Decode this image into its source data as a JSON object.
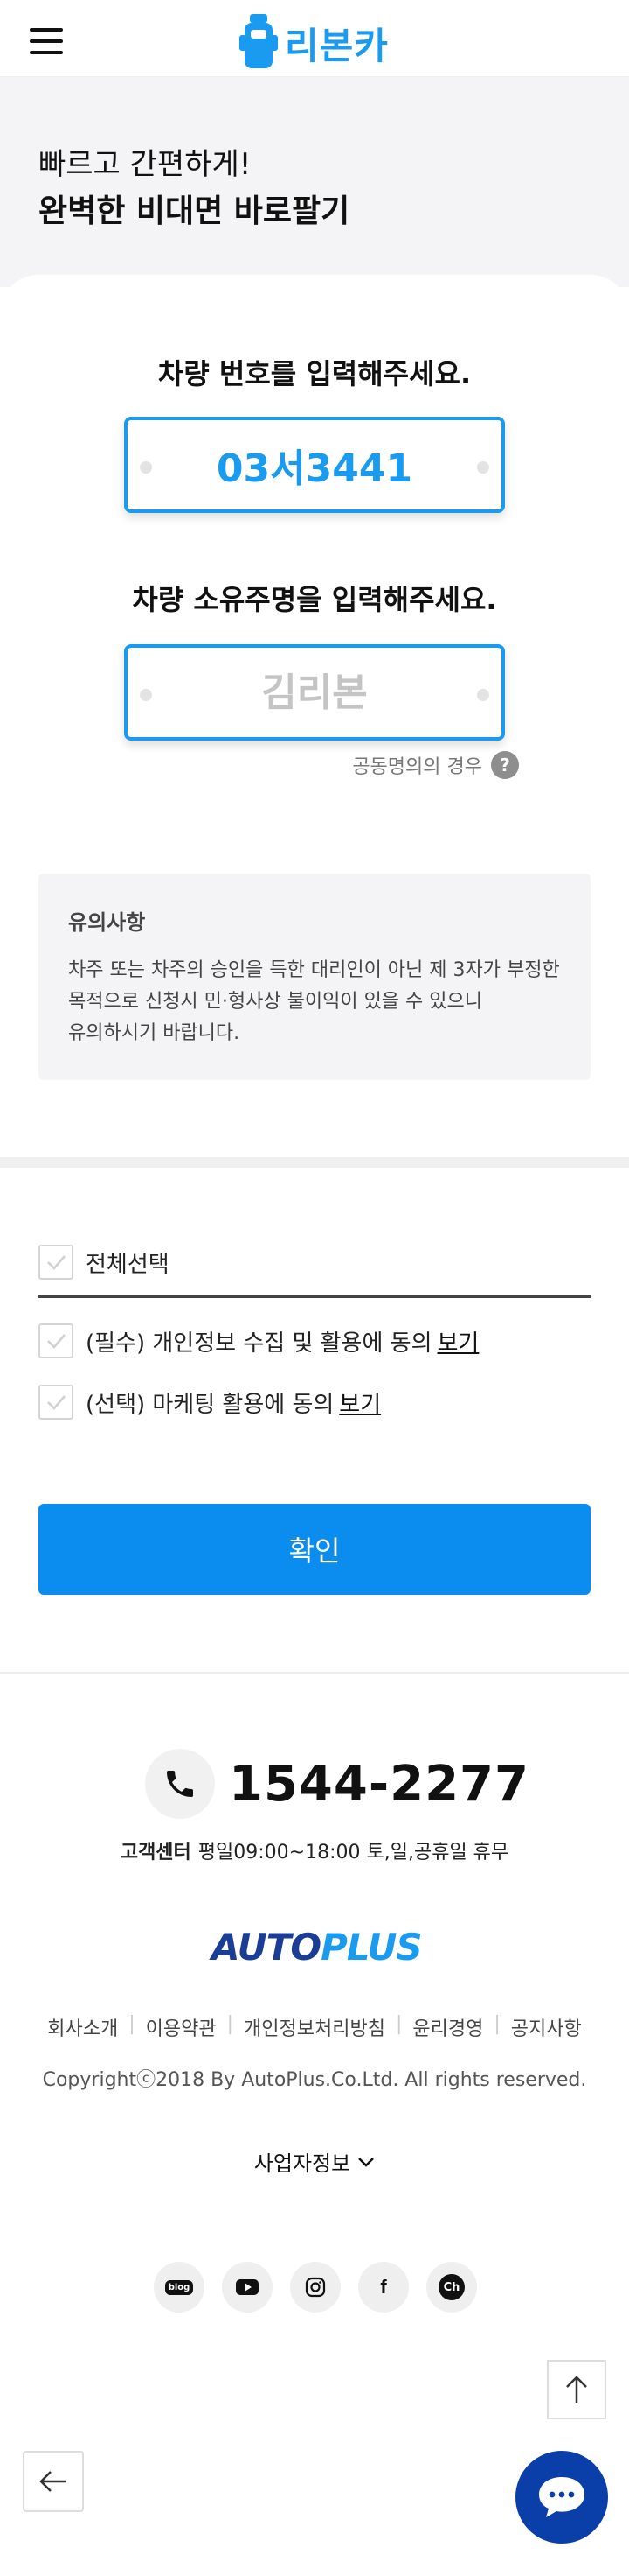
{
  "header": {
    "logo_text": "리본카",
    "menu_icon": "hamburger-menu-icon",
    "brand_color": "#1a9bf0"
  },
  "hero": {
    "subtitle": "빠르고 간편하게!",
    "title": "완벽한 비대면 바로팔기"
  },
  "form": {
    "plate_label": "차량 번호를 입력해주세요.",
    "plate_value": "03서3441",
    "owner_label": "차량 소유주명을 입력해주세요.",
    "owner_placeholder": "김리본",
    "co_owner_link": "공동명의의 경우",
    "help_icon_text": "?"
  },
  "notice": {
    "title": "유의사항",
    "line1": "차주 또는 차주의 승인을 득한 대리인이 아닌 제 3자가 부정한",
    "line2": "목적으로 신청시 민·형사상 불이익이 있을 수 있으니",
    "line3": "유의하시기 바랍니다."
  },
  "agreements": {
    "select_all": "전체선택",
    "required": "(필수) 개인정보 수집 및 활용에 동의",
    "optional": "(선택) 마케팅 활용에 동의",
    "view_label": "보기",
    "confirm_button": "확인",
    "button_color": "#0b8df0"
  },
  "footer": {
    "phone": "1544-2277",
    "cs_label": "고객센터",
    "cs_hours": "평일09:00~18:00 토,일,공휴일 휴무",
    "brand_part1": "AUTO",
    "brand_part2": "PLUS",
    "links": [
      "회사소개",
      "이용약관",
      "개인정보처리방침",
      "윤리경영",
      "공지사항"
    ],
    "copyright": "Copyrightⓒ2018 By AutoPlus.Co.Ltd. All rights reserved.",
    "business_info": "사업자정보",
    "social": [
      "blog",
      "youtube",
      "instagram",
      "facebook",
      "kakao-channel"
    ],
    "blog_text": "blog",
    "facebook_text": "f",
    "kakao_text": "Ch"
  },
  "floating": {
    "to_top_icon": "arrow-up-icon",
    "back_icon": "arrow-left-icon",
    "chat_icon": "chat-bubble-icon"
  }
}
